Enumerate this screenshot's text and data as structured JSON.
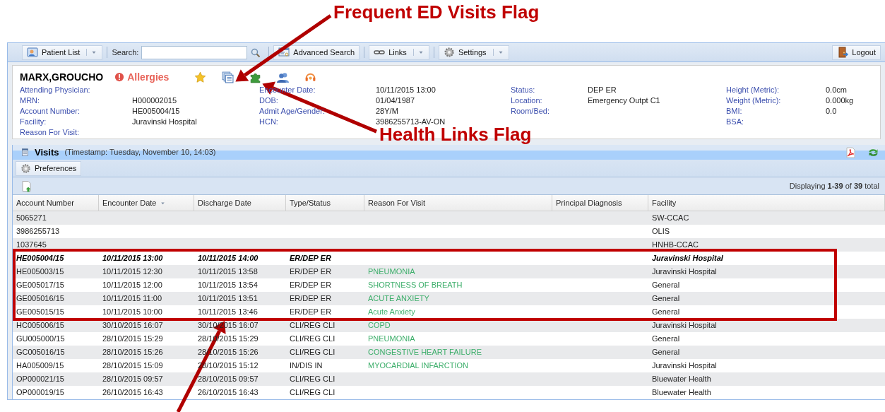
{
  "annotations": {
    "labels": [
      "Frequent ED Visits Flag",
      "Health Links Flag"
    ]
  },
  "toolbar": {
    "patient_list": "Patient List",
    "search_label": "Search:",
    "advanced_search": "Advanced Search",
    "links": "Links",
    "settings": "Settings",
    "logout": "Logout"
  },
  "patient": {
    "name": "MARX,GROUCHO",
    "allergies": "Allergies",
    "columns": [
      {
        "rows": [
          {
            "label": "Attending Physician:"
          },
          {
            "label": "MRN:",
            "value": "H000002015"
          },
          {
            "label": "Account Number:",
            "value": "HE005004/15"
          },
          {
            "label": "Facility:",
            "value": "Juravinski Hospital"
          },
          {
            "label": "Reason For Visit:"
          }
        ]
      },
      {
        "rows": [
          {
            "label": "Encounter Date:",
            "value": "10/11/2015 13:00"
          },
          {
            "label": "DOB:",
            "value": "01/04/1987"
          },
          {
            "label": "Admit Age/Gender:",
            "value": "28Y/M"
          },
          {
            "label": "HCN:",
            "value": "3986255713-AV-ON"
          }
        ]
      },
      {
        "rows": [
          {
            "label": "Status:",
            "value": "DEP ER"
          },
          {
            "label": "Location:",
            "value": "Emergency Outpt C1"
          },
          {
            "label": "Room/Bed:"
          }
        ]
      },
      {
        "rows": [
          {
            "label": "Height (Metric):",
            "value": "0.0cm"
          },
          {
            "label": "Weight (Metric):",
            "value": "0.000kg"
          },
          {
            "label": "BMI:",
            "value": "0.0"
          },
          {
            "label": "BSA:"
          }
        ]
      }
    ]
  },
  "visits": {
    "title": "Visits",
    "timestamp": "(Timestamp: Tuesday, November 10, 14:03)",
    "preferences": "Preferences",
    "paging": "Displaying **1-39** of **39** total",
    "columns": [
      {
        "label": "Account Number",
        "sorted": false
      },
      {
        "label": "Encounter Date",
        "sorted": true
      },
      {
        "label": "Discharge Date",
        "sorted": false
      },
      {
        "label": "Type/Status",
        "sorted": false
      },
      {
        "label": "Reason For Visit",
        "sorted": false
      },
      {
        "label": "Principal Diagnosis",
        "sorted": false
      },
      {
        "label": "Facility",
        "sorted": false
      }
    ],
    "rows": [
      {
        "current": false,
        "account": "5065271",
        "facility": "SW-CCAC"
      },
      {
        "current": false,
        "account": "3986255713",
        "facility": "OLIS"
      },
      {
        "current": false,
        "account": "1037645",
        "facility": "HNHB-CCAC"
      },
      {
        "current": true,
        "account": "HE005004/15",
        "encounter_date": "10/11/2015 13:00",
        "discharge_date": "10/11/2015 14:00",
        "type_status": "ER/DEP ER",
        "facility": "Juravinski Hospital"
      },
      {
        "current": false,
        "account": "HE005003/15",
        "encounter_date": "10/11/2015 12:30",
        "discharge_date": "10/11/2015 13:58",
        "type_status": "ER/DEP ER",
        "reason": "PNEUMONIA",
        "facility": "Juravinski Hospital"
      },
      {
        "current": false,
        "account": "GE005017/15",
        "encounter_date": "10/11/2015 12:00",
        "discharge_date": "10/11/2015 13:54",
        "type_status": "ER/DEP ER",
        "reason": "SHORTNESS OF BREATH",
        "facility": "General"
      },
      {
        "current": false,
        "account": "GE005016/15",
        "encounter_date": "10/11/2015 11:00",
        "discharge_date": "10/11/2015 13:51",
        "type_status": "ER/DEP ER",
        "reason": "ACUTE ANXIETY",
        "facility": "General"
      },
      {
        "current": false,
        "account": "GE005015/15",
        "encounter_date": "10/11/2015 10:00",
        "discharge_date": "10/11/2015 13:46",
        "type_status": "ER/DEP ER",
        "reason": "Acute Anxiety",
        "facility": "General"
      },
      {
        "current": false,
        "account": "HC005006/15",
        "encounter_date": "30/10/2015 16:07",
        "discharge_date": "30/10/2015 16:07",
        "type_status": "CLI/REG CLI",
        "reason": "COPD",
        "facility": "Juravinski Hospital"
      },
      {
        "current": false,
        "account": "GU005000/15",
        "encounter_date": "28/10/2015 15:29",
        "discharge_date": "28/10/2015 15:29",
        "type_status": "CLI/REG CLI",
        "reason": "PNEUMONIA",
        "facility": "General"
      },
      {
        "current": false,
        "account": "GC005016/15",
        "encounter_date": "28/10/2015 15:26",
        "discharge_date": "28/10/2015 15:26",
        "type_status": "CLI/REG CLI",
        "reason": "CONGESTIVE HEART FAILURE",
        "facility": "General"
      },
      {
        "current": false,
        "account": "HA005009/15",
        "encounter_date": "28/10/2015 15:09",
        "discharge_date": "28/10/2015 15:12",
        "type_status": "IN/DIS IN",
        "reason": "MYOCARDIAL INFARCTION",
        "facility": "Juravinski Hospital"
      },
      {
        "current": false,
        "account": "OP000021/15",
        "encounter_date": "28/10/2015 09:57",
        "discharge_date": "28/10/2015 09:57",
        "type_status": "CLI/REG CLI",
        "facility": "Bluewater Health"
      },
      {
        "current": false,
        "account": "OP000019/15",
        "encounter_date": "26/10/2015 16:43",
        "discharge_date": "26/10/2015 16:43",
        "type_status": "CLI/REG CLI",
        "facility": "Bluewater Health"
      }
    ]
  }
}
